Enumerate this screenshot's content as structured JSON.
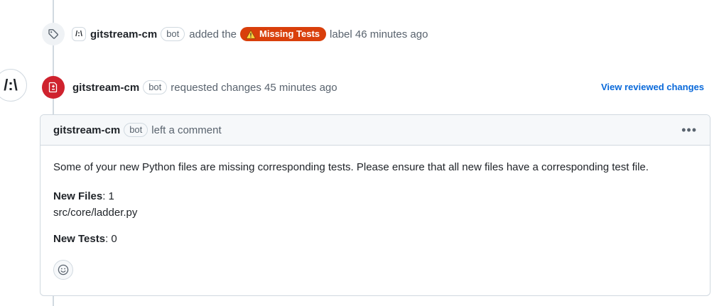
{
  "label_event": {
    "actor": "gitstream-cm",
    "bot_tag": "bot",
    "action_before": "added the",
    "label": "Missing Tests",
    "action_after": "label 46 minutes ago",
    "label_color": "#d93f0b",
    "avatar_text": "/:\\"
  },
  "review_event": {
    "actor": "gitstream-cm",
    "bot_tag": "bot",
    "action": "requested changes 45 minutes ago",
    "link": "View reviewed changes",
    "icon_color": "#cf222e",
    "avatar_text": "/:\\"
  },
  "comment": {
    "author": "gitstream-cm",
    "bot_tag": "bot",
    "action": "left a comment",
    "menu_glyph": "•••",
    "intro": "Some of your new Python files are missing corresponding tests. Please ensure that all new files have a corresponding test file.",
    "new_files_label": "New Files",
    "new_files_value": ": 1",
    "file_path": "src/core/ladder.py",
    "new_tests_label": "New Tests",
    "new_tests_value": ": 0"
  }
}
